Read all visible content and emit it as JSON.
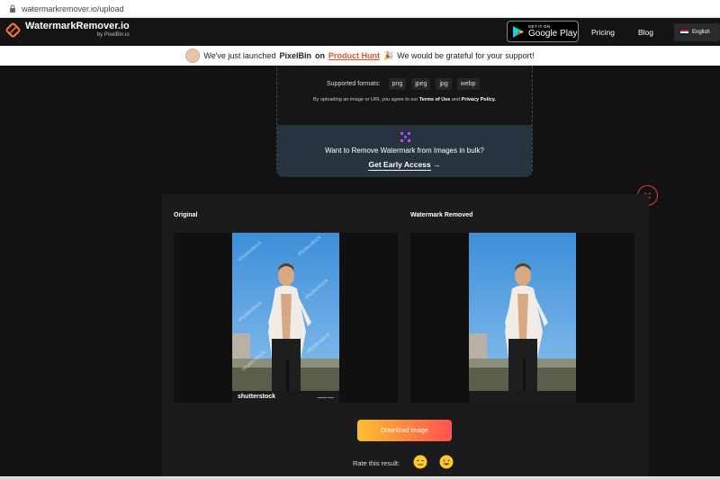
{
  "browser": {
    "url": "watermarkremover.io/upload"
  },
  "nav": {
    "logo_title": "WatermarkRemover.io",
    "logo_sub": "by PixelBin.io",
    "gplay_small": "GET IT ON",
    "gplay_big": "Google Play",
    "links": [
      "Pricing",
      "Blog"
    ],
    "language": "English"
  },
  "banner": {
    "pre": "We've just launched",
    "brand": "PixelBin",
    "on": "on",
    "product_hunt": "Product Hunt",
    "post": "We would be grateful for your support!"
  },
  "upload": {
    "formats_label": "Supported formats:",
    "formats": [
      "png",
      "jpeg",
      "jpg",
      "webp"
    ],
    "terms_pre": "By uploading an image or URL you agree to our",
    "terms_link": "Terms of Use",
    "terms_and": "and",
    "privacy_link": "Privacy Policy."
  },
  "bulk": {
    "question": "Want to Remove Watermark from Images in bulk?",
    "cta": "Get Early Access",
    "cta_arrow": "→"
  },
  "result": {
    "close_glyph": "✕",
    "original_label": "Original",
    "removed_label": "Watermark Removed",
    "watermark_text": "shutterstock",
    "download_label": "Download Image",
    "rate_label": "Rate this result:"
  },
  "colors": {
    "accent": "#da552f",
    "card_blue": "#27333f",
    "close_red": "#e53935"
  }
}
